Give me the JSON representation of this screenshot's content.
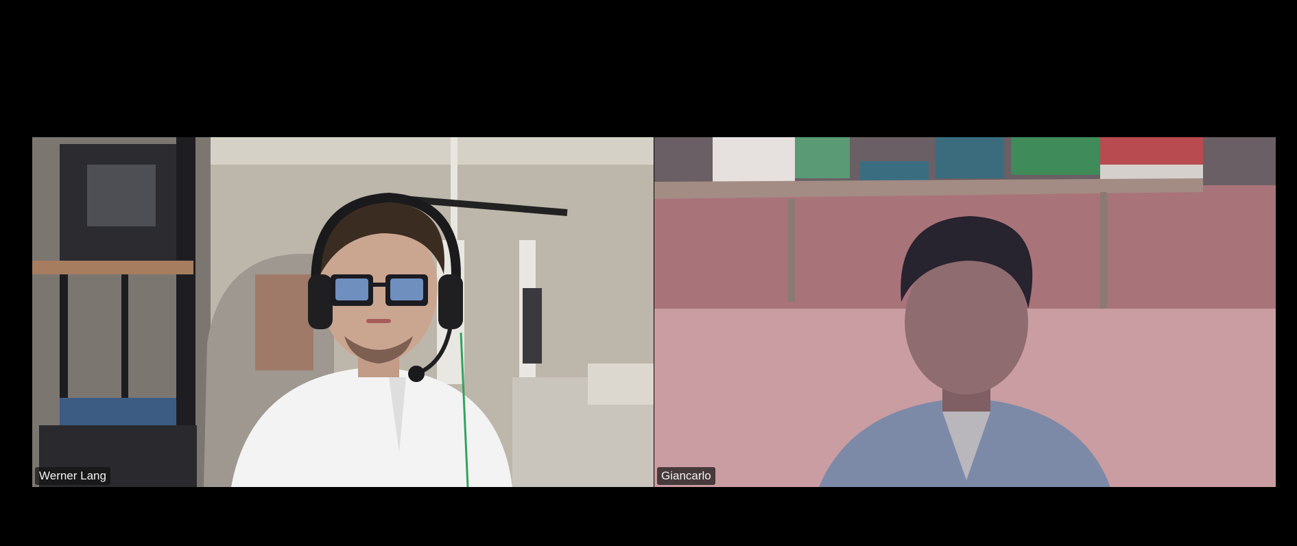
{
  "meeting": {
    "participants": [
      {
        "name": "Werner Lang",
        "scene": {
          "wall": "#bdb8ae",
          "wall_shadow": "#8f8a80",
          "shirt": "#f4f4f4",
          "hair": "#3a2b22",
          "skin": "#c9a48e"
        }
      },
      {
        "name": "Giancarlo",
        "scene": {
          "wall": "#c08f93",
          "shelf": "#a98a7e",
          "shirt": "#7f8fb0",
          "hair": "#262232",
          "skin": "#8e6b6e"
        }
      }
    ]
  }
}
